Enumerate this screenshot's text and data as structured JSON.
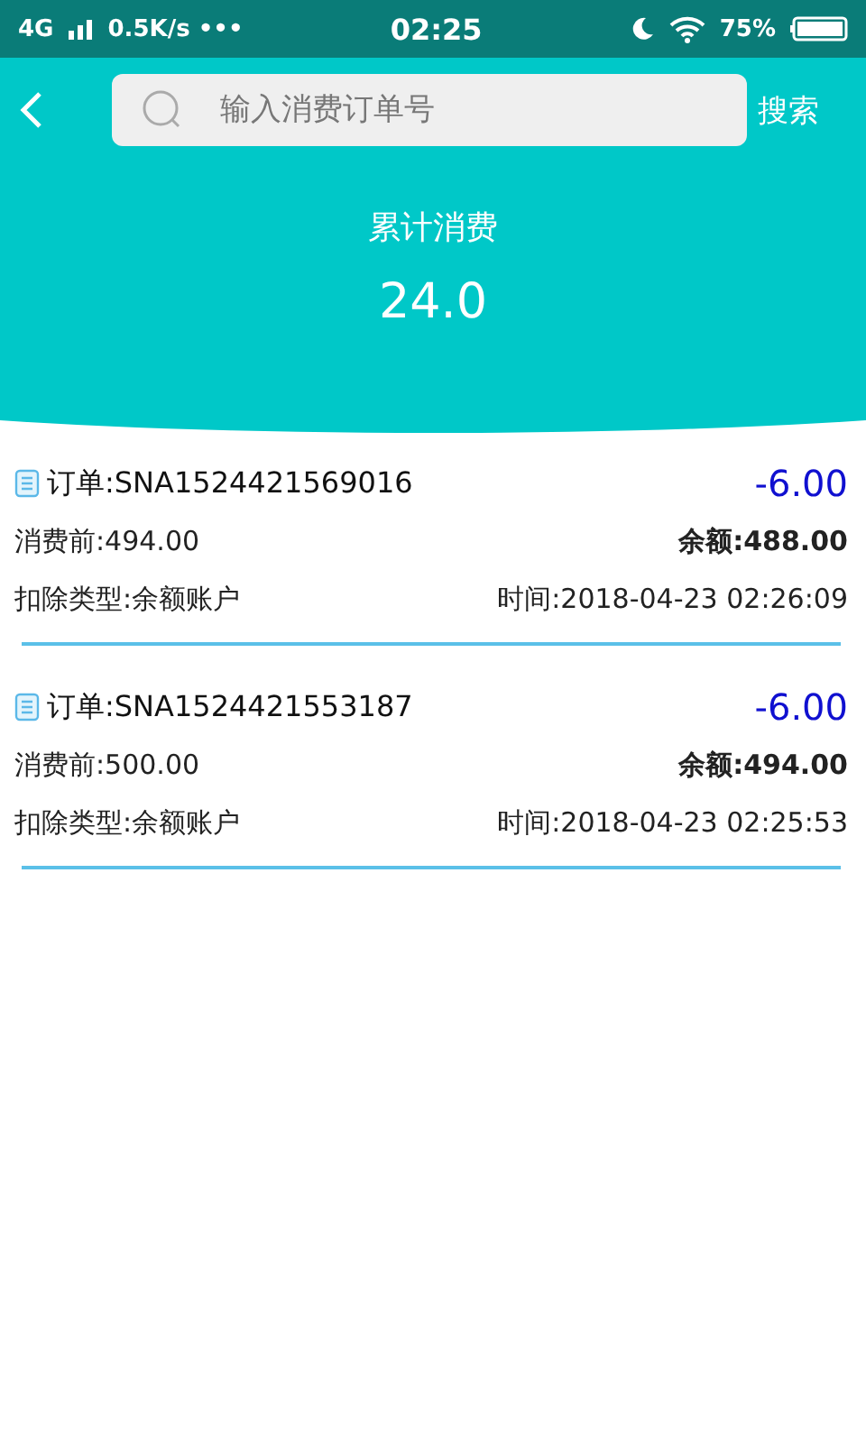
{
  "status_bar": {
    "network": "4G",
    "speed": "0.5K/s",
    "dots": "•••",
    "time": "02:25",
    "battery": "75%"
  },
  "search": {
    "placeholder": "输入消费订单号",
    "button": "搜索"
  },
  "summary": {
    "label": "累计消费",
    "total": "24.0"
  },
  "orders": [
    {
      "order": "订单:SNA1524421569016",
      "amount": "-6.00",
      "before": "消费前:494.00",
      "balance_label": "余额:",
      "balance": "488.00",
      "type": "扣除类型:余额账户",
      "time": "时间:2018-04-23 02:26:09"
    },
    {
      "order": "订单:SNA1524421553187",
      "amount": "-6.00",
      "before": "消费前:500.00",
      "balance_label": "余额:",
      "balance": "494.00",
      "type": "扣除类型:余额账户",
      "time": "时间:2018-04-23 02:25:53"
    }
  ]
}
